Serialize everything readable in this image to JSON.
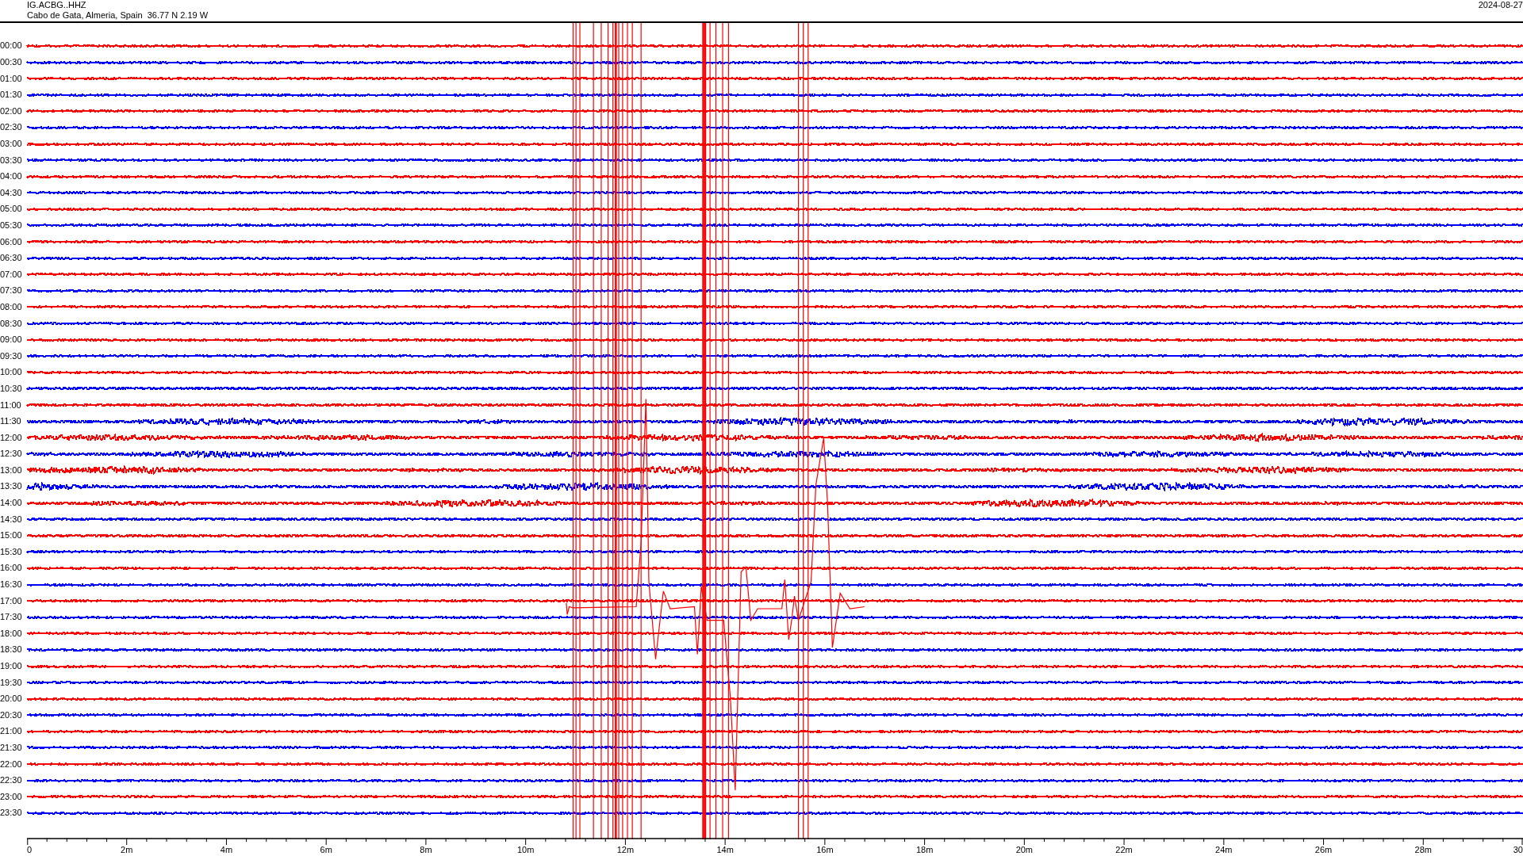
{
  "header": {
    "station": "IG.ACBG..HHZ",
    "location": "Cabo de Gata, Almeria, Spain  36.77 N 2.19 W",
    "date": "2024-08-27"
  },
  "rows": [
    {
      "time": "00:00",
      "color": "#ff0000"
    },
    {
      "time": "00:30",
      "color": "#0000ff"
    },
    {
      "time": "01:00",
      "color": "#ff0000"
    },
    {
      "time": "01:30",
      "color": "#0000ff"
    },
    {
      "time": "02:00",
      "color": "#ff0000"
    },
    {
      "time": "02:30",
      "color": "#0000ff"
    },
    {
      "time": "03:00",
      "color": "#ff0000"
    },
    {
      "time": "03:30",
      "color": "#0000ff"
    },
    {
      "time": "04:00",
      "color": "#ff0000"
    },
    {
      "time": "04:30",
      "color": "#0000ff"
    },
    {
      "time": "05:00",
      "color": "#ff0000"
    },
    {
      "time": "05:30",
      "color": "#0000ff"
    },
    {
      "time": "06:00",
      "color": "#ff0000"
    },
    {
      "time": "06:30",
      "color": "#0000ff"
    },
    {
      "time": "07:00",
      "color": "#ff0000"
    },
    {
      "time": "07:30",
      "color": "#0000ff"
    },
    {
      "time": "08:00",
      "color": "#ff0000"
    },
    {
      "time": "08:30",
      "color": "#0000ff"
    },
    {
      "time": "09:00",
      "color": "#ff0000"
    },
    {
      "time": "09:30",
      "color": "#0000ff"
    },
    {
      "time": "10:00",
      "color": "#ff0000"
    },
    {
      "time": "10:30",
      "color": "#0000ff"
    },
    {
      "time": "11:00",
      "color": "#ff0000"
    },
    {
      "time": "11:30",
      "color": "#0000ff"
    },
    {
      "time": "12:00",
      "color": "#ff0000"
    },
    {
      "time": "12:30",
      "color": "#0000ff"
    },
    {
      "time": "13:00",
      "color": "#ff0000"
    },
    {
      "time": "13:30",
      "color": "#0000ff"
    },
    {
      "time": "14:00",
      "color": "#ff0000"
    },
    {
      "time": "14:30",
      "color": "#0000ff"
    },
    {
      "time": "15:00",
      "color": "#ff0000"
    },
    {
      "time": "15:30",
      "color": "#0000ff"
    },
    {
      "time": "16:00",
      "color": "#ff0000"
    },
    {
      "time": "16:30",
      "color": "#0000ff"
    },
    {
      "time": "17:00",
      "color": "#ff0000"
    },
    {
      "time": "17:30",
      "color": "#0000ff"
    },
    {
      "time": "18:00",
      "color": "#ff0000"
    },
    {
      "time": "18:30",
      "color": "#0000ff"
    },
    {
      "time": "19:00",
      "color": "#ff0000"
    },
    {
      "time": "19:30",
      "color": "#0000ff"
    },
    {
      "time": "20:00",
      "color": "#ff0000"
    },
    {
      "time": "20:30",
      "color": "#0000ff"
    },
    {
      "time": "21:00",
      "color": "#ff0000"
    },
    {
      "time": "21:30",
      "color": "#0000ff"
    },
    {
      "time": "22:00",
      "color": "#ff0000"
    },
    {
      "time": "22:30",
      "color": "#0000ff"
    },
    {
      "time": "23:00",
      "color": "#ff0000"
    },
    {
      "time": "23:30",
      "color": "#0000ff"
    }
  ],
  "x_axis": {
    "ticks": [
      "0",
      "2m",
      "4m",
      "6m",
      "8m",
      "10m",
      "12m",
      "14m",
      "16m",
      "18m",
      "20m",
      "22m",
      "24m",
      "26m",
      "28m",
      "30"
    ]
  }
}
